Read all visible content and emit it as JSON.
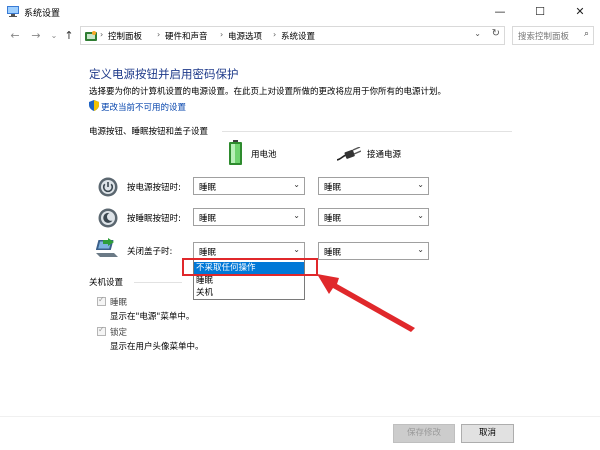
{
  "window": {
    "title": "系统设置",
    "minimize": "—",
    "maximize": "☐",
    "close": "✕"
  },
  "nav": {
    "back": "←",
    "forward": "→",
    "recent": "⌄",
    "up": "↑"
  },
  "breadcrumb": {
    "items": [
      "控制面板",
      "硬件和声音",
      "电源选项",
      "系统设置"
    ],
    "separator": "›",
    "dropdown": "⌄",
    "refresh": "↻"
  },
  "search": {
    "placeholder": "搜索控制面板",
    "icon": "⌕"
  },
  "page": {
    "heading": "定义电源按钮并启用密码保护",
    "subtext": "选择要为你的计算机设置的电源设置。在此页上对设置所做的更改将应用于你所有的电源计划。",
    "change_link": "更改当前不可用的设置"
  },
  "buttons_section": {
    "title": "电源按钮、睡眠按钮和盖子设置",
    "col_battery": "用电池",
    "col_plugged": "接通电源",
    "rows": [
      {
        "label": "按电源按钮时:",
        "battery": "睡眠",
        "plugged": "睡眠"
      },
      {
        "label": "按睡眠按钮时:",
        "battery": "睡眠",
        "plugged": "睡眠"
      },
      {
        "label": "关闭盖子时:",
        "battery": "睡眠",
        "plugged": "睡眠"
      }
    ],
    "arrow": "⌄"
  },
  "dropdown_options": [
    "不采取任何操作",
    "睡眠",
    "关机"
  ],
  "shutdown_section": {
    "title": "关机设置",
    "items": [
      {
        "label": "睡眠",
        "desc": "显示在\"电源\"菜单中。"
      },
      {
        "label": "锁定",
        "desc": "显示在用户头像菜单中。"
      }
    ],
    "check": "✓"
  },
  "footer": {
    "save": "保存修改",
    "cancel": "取消"
  },
  "colors": {
    "heading": "#1e3a8a",
    "link": "#0645ad",
    "selection": "#0078d7",
    "highlight_box": "#e0282b"
  },
  "icons": [
    "control-panel-icon",
    "shield-icon",
    "battery-icon",
    "plug-icon",
    "power-button-icon",
    "sleep-button-icon",
    "laptop-lid-icon",
    "red-arrow"
  ]
}
